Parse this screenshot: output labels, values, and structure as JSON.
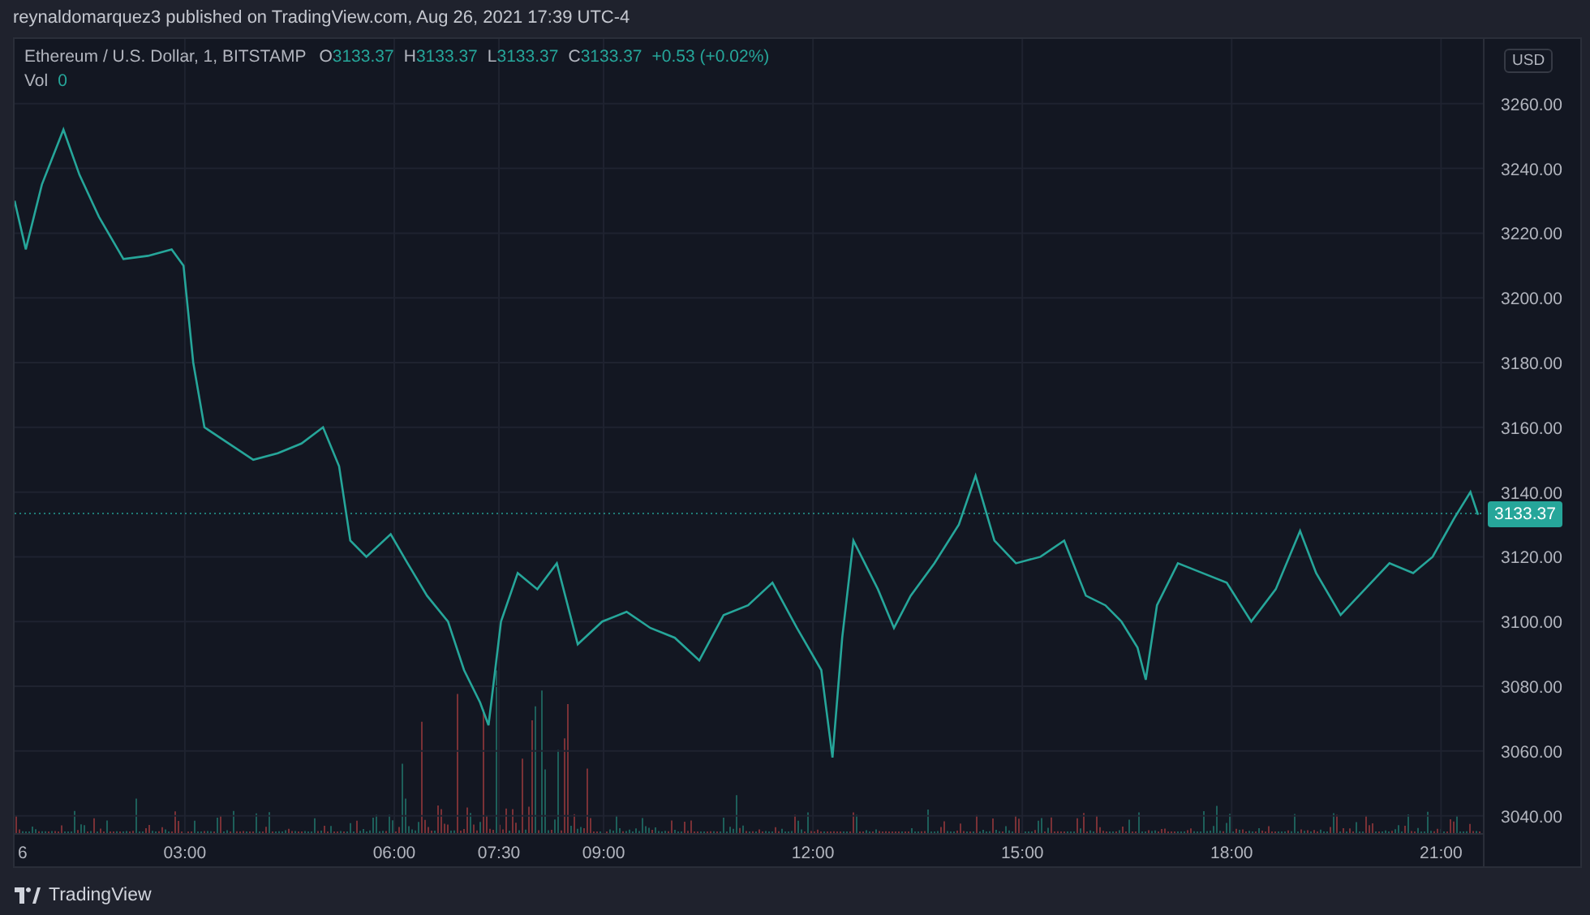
{
  "header": {
    "text": "reynaldomarquez3 published on TradingView.com, Aug 26, 2021 17:39 UTC-4"
  },
  "legend": {
    "symbol": "Ethereum / U.S. Dollar, 1, BITSTAMP",
    "ohlc": [
      {
        "label": "O",
        "value": "3133.37"
      },
      {
        "label": "H",
        "value": "3133.37"
      },
      {
        "label": "L",
        "value": "3133.37"
      },
      {
        "label": "C",
        "value": "3133.37"
      }
    ],
    "change": "+0.53 (+0.02%)",
    "volume": {
      "label": "Vol",
      "value": "0"
    }
  },
  "chart": {
    "date_fragment": "6",
    "currency": "USD",
    "chart_data": {
      "ref_lines": [
        {
          "axis": "y",
          "value": 3133.37,
          "label": "3133.37",
          "color": "#26a69a"
        }
      ],
      "type": "line",
      "x": [
        0.56,
        0.72,
        0.95,
        1.26,
        1.49,
        1.77,
        2.12,
        2.47,
        2.81,
        2.98,
        3.12,
        3.28,
        3.63,
        3.98,
        4.33,
        4.67,
        4.98,
        5.21,
        5.37,
        5.6,
        5.95,
        6.19,
        6.47,
        6.77,
        7.0,
        7.23,
        7.35,
        7.53,
        7.77,
        8.05,
        8.33,
        8.63,
        8.98,
        9.33,
        9.67,
        10.02,
        10.37,
        10.72,
        11.07,
        11.42,
        11.77,
        12.12,
        12.28,
        12.42,
        12.58,
        12.93,
        13.16,
        13.4,
        13.74,
        14.09,
        14.33,
        14.6,
        14.91,
        15.26,
        15.6,
        15.91,
        16.19,
        16.42,
        16.65,
        16.77,
        16.93,
        17.23,
        17.58,
        17.93,
        18.28,
        18.63,
        18.98,
        19.21,
        19.56,
        19.91,
        20.26,
        20.6,
        20.88,
        21.19,
        21.42,
        21.53
      ],
      "series": [
        {
          "color": "#26a69a",
          "values": [
            3230,
            3215,
            3235,
            3252,
            3238,
            3225,
            3212,
            3213,
            3215,
            3210,
            3180,
            3160,
            3155,
            3150,
            3152,
            3155,
            3160,
            3148,
            3125,
            3120,
            3127,
            3118,
            3108,
            3100,
            3085,
            3075,
            3068,
            3100,
            3115,
            3110,
            3118,
            3093,
            3100,
            3103,
            3098,
            3095,
            3088,
            3102,
            3105,
            3112,
            3098,
            3085,
            3058,
            3095,
            3125,
            3110,
            3098,
            3108,
            3118,
            3130,
            3145,
            3125,
            3118,
            3120,
            3125,
            3108,
            3105,
            3100,
            3092,
            3082,
            3105,
            3118,
            3115,
            3112,
            3100,
            3110,
            3128,
            3115,
            3102,
            3110,
            3118,
            3115,
            3120,
            3132,
            3140,
            3133
          ]
        }
      ],
      "grid": true,
      "xlim": [
        0.56,
        21.6
      ],
      "ylim": [
        3034.4,
        3280
      ],
      "xticks": [
        {
          "value": 3,
          "label": "03:00"
        },
        {
          "value": 6,
          "label": "06:00"
        },
        {
          "value": 7.5,
          "label": "07:30"
        },
        {
          "value": 9,
          "label": "09:00"
        },
        {
          "value": 12,
          "label": "12:00"
        },
        {
          "value": 15,
          "label": "15:00"
        },
        {
          "value": 18,
          "label": "18:00"
        },
        {
          "value": 21,
          "label": "21:00"
        }
      ],
      "yticks": [
        {
          "value": 3040,
          "label": "3040.00"
        },
        {
          "value": 3060,
          "label": "3060.00"
        },
        {
          "value": 3080,
          "label": "3080.00"
        },
        {
          "value": 3100,
          "label": "3100.00"
        },
        {
          "value": 3120,
          "label": "3120.00"
        },
        {
          "value": 3140,
          "label": "3140.00"
        },
        {
          "value": 3160,
          "label": "3160.00"
        },
        {
          "value": 3180,
          "label": "3180.00"
        },
        {
          "value": 3200,
          "label": "3200.00"
        },
        {
          "value": 3220,
          "label": "3220.00"
        },
        {
          "value": 3240,
          "label": "3240.00"
        },
        {
          "value": 3260,
          "label": "3260.00"
        }
      ]
    }
  },
  "footer": {
    "brand": "TradingView"
  }
}
